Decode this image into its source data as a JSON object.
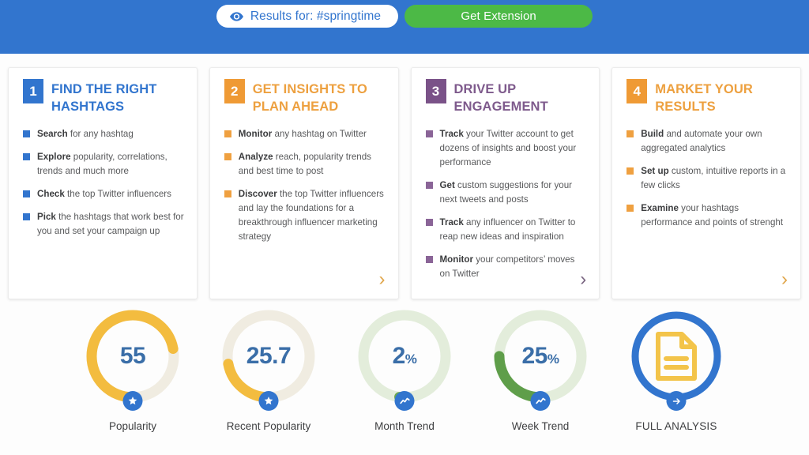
{
  "header": {
    "results_pill": {
      "icon": "eye-icon",
      "label": "Results for: #springtime"
    },
    "get_extension": {
      "label": "Get Extension"
    },
    "bg_color": "#3275ce",
    "button_color": "#4cb946"
  },
  "cards": [
    {
      "number": "1",
      "title": "FIND THE RIGHT HASHTAGS",
      "theme": "blue",
      "color": "#3275ce",
      "chevron": false,
      "bullets": [
        {
          "lead": "Search",
          "rest": " for any hashtag"
        },
        {
          "lead": "Explore",
          "rest": " popularity, correlations, trends and much more"
        },
        {
          "lead": "Check",
          "rest": " the top Twitter influencers"
        },
        {
          "lead": "Pick",
          "rest": " the hashtags that work best for you and set your campaign up"
        }
      ]
    },
    {
      "number": "2",
      "title": "GET INSIGHTS TO PLAN AHEAD",
      "theme": "orange",
      "color": "#eda03f",
      "chevron": true,
      "bullets": [
        {
          "lead": "Monitor",
          "rest": " any hashtag on Twitter"
        },
        {
          "lead": "Analyze",
          "rest": " reach, popularity trends and best time to post"
        },
        {
          "lead": "Discover",
          "rest": " the top Twitter influencers and lay the foundations for a breakthrough influencer marketing strategy"
        }
      ]
    },
    {
      "number": "3",
      "title": "DRIVE UP ENGAGEMENT",
      "theme": "purple",
      "color": "#7e5a8c",
      "chevron": true,
      "bullets": [
        {
          "lead": "Track",
          "rest": " your Twitter account to get dozens of insights and boost your performance"
        },
        {
          "lead": "Get",
          "rest": " custom suggestions for your next tweets and posts"
        },
        {
          "lead": "Track",
          "rest": " any influencer on Twitter to reap new ideas and inspiration"
        },
        {
          "lead": "Monitor",
          "rest": " your competitors’ moves on Twitter"
        }
      ]
    },
    {
      "number": "4",
      "title": "MARKET YOUR RESULTS",
      "theme": "orange",
      "color": "#eda03f",
      "chevron": true,
      "bullets": [
        {
          "lead": "Build",
          "rest": " and automate your own aggregated analytics"
        },
        {
          "lead": "Set up",
          "rest": " custom, intuitive reports in a few clicks"
        },
        {
          "lead": "Examine",
          "rest": " your hashtags performance and points of strenght"
        }
      ]
    }
  ],
  "chevron_glyph": "›",
  "gauges": [
    {
      "label": "Popularity",
      "value": "55",
      "suffix": "",
      "percent": 72,
      "arc_color": "#f3bc3f",
      "track_color": "#f0ece1",
      "badge_icon": "star-icon"
    },
    {
      "label": "Recent Popularity",
      "value": "25.7",
      "suffix": "",
      "percent": 22,
      "arc_color": "#f3bc3f",
      "track_color": "#f0ece1",
      "badge_icon": "star-icon"
    },
    {
      "label": "Month Trend",
      "value": "2",
      "suffix": "%",
      "percent": 2,
      "arc_color": "#6aa84f",
      "track_color": "#e3eddb",
      "badge_icon": "trend-icon"
    },
    {
      "label": "Week Trend",
      "value": "25",
      "suffix": "%",
      "percent": 25,
      "arc_color": "#5f9e4a",
      "track_color": "#e3eddb",
      "badge_icon": "trend-icon"
    }
  ],
  "full_analysis": {
    "label": "FULL ANALYSIS",
    "ring_color": "#3275ce",
    "doc_color": "#f3c44a",
    "badge_icon": "arrow-right-icon",
    "doc_icon": "document-icon"
  }
}
